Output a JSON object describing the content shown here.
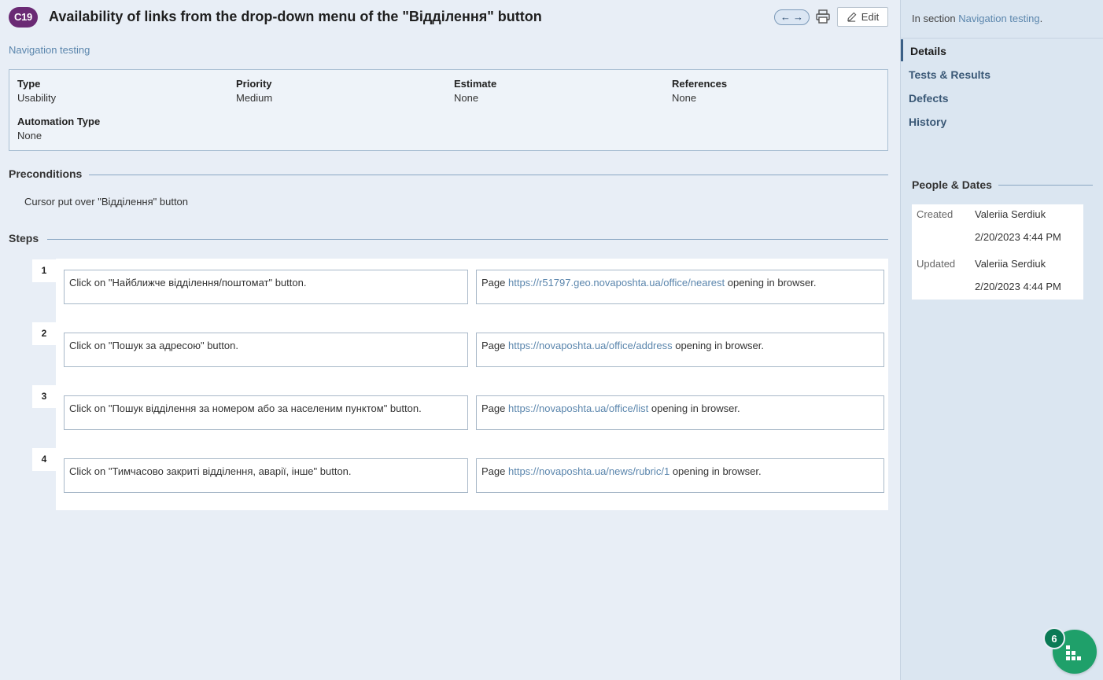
{
  "header": {
    "case_id": "C19",
    "title": "Availability of links from the drop-down menu of the \"Відділення\" button",
    "nav_prev_icon": "arrow-left-icon",
    "nav_next_icon": "arrow-right-icon",
    "print_icon": "printer-icon",
    "edit_icon": "pencil-icon",
    "edit_label": "Edit"
  },
  "breadcrumb": {
    "section": "Navigation testing"
  },
  "fields": {
    "type": {
      "label": "Type",
      "value": "Usability"
    },
    "priority": {
      "label": "Priority",
      "value": "Medium"
    },
    "estimate": {
      "label": "Estimate",
      "value": "None"
    },
    "references": {
      "label": "References",
      "value": "None"
    },
    "automation_type": {
      "label": "Automation Type",
      "value": "None"
    }
  },
  "preconditions": {
    "heading": "Preconditions",
    "text": "Cursor put over \"Відділення\" button"
  },
  "steps": {
    "heading": "Steps",
    "items": [
      {
        "num": "1",
        "content": "Click on \"Найближче відділення/поштомат\" button.",
        "expected_prefix": "Page ",
        "expected_link": "https://r51797.geo.novaposhta.ua/office/nearest",
        "expected_suffix": " opening in browser."
      },
      {
        "num": "2",
        "content": "Click on \"Пошук за адресою\" button.",
        "expected_prefix": "Page ",
        "expected_link": "https://novaposhta.ua/office/address",
        "expected_suffix": " opening in browser."
      },
      {
        "num": "3",
        "content": "Click on \"Пошук відділення за номером або за населеним пунктом\" button.",
        "expected_prefix": "Page ",
        "expected_link": "https://novaposhta.ua/office/list",
        "expected_suffix": " opening in browser."
      },
      {
        "num": "4",
        "content": "Click on \"Тимчасово закриті відділення, аварії, інше\" button.",
        "expected_prefix": "Page ",
        "expected_link": "https://novaposhta.ua/news/rubric/1",
        "expected_suffix": " opening in browser."
      }
    ]
  },
  "sidebar": {
    "in_section_prefix": "In section ",
    "in_section_link": "Navigation testing",
    "in_section_suffix": ".",
    "nav": [
      {
        "label": "Details"
      },
      {
        "label": "Tests & Results"
      },
      {
        "label": "Defects"
      },
      {
        "label": "History"
      }
    ],
    "people_dates": {
      "heading": "People & Dates",
      "created_label": "Created",
      "created_by": "Valeriia Serdiuk",
      "created_at": "2/20/2023 4:44 PM",
      "updated_label": "Updated",
      "updated_by": "Valeriia Serdiuk",
      "updated_at": "2/20/2023 4:44 PM"
    }
  },
  "fab": {
    "badge": "6",
    "icon": "grid-apps-icon"
  },
  "colors": {
    "case_badge": "#6a2a74",
    "link": "#5b86ad",
    "fab": "#1fa06a"
  }
}
